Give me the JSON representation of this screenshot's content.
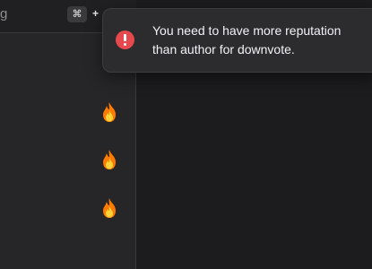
{
  "search": {
    "text": "g",
    "shortcut_key": "⌘",
    "shortcut_plus": "+"
  },
  "list": {
    "items": [
      {
        "icon": "fire-icon"
      },
      {
        "icon": "fire-icon"
      },
      {
        "icon": "fire-icon"
      }
    ]
  },
  "toast": {
    "icon": "error-icon",
    "message": "You need to have more reputation than author for downvote.",
    "accent_color": "#e5484d"
  },
  "colors": {
    "background": "#1c1c1e",
    "panel": "#262628",
    "toast_bg": "#2c2c2e"
  }
}
